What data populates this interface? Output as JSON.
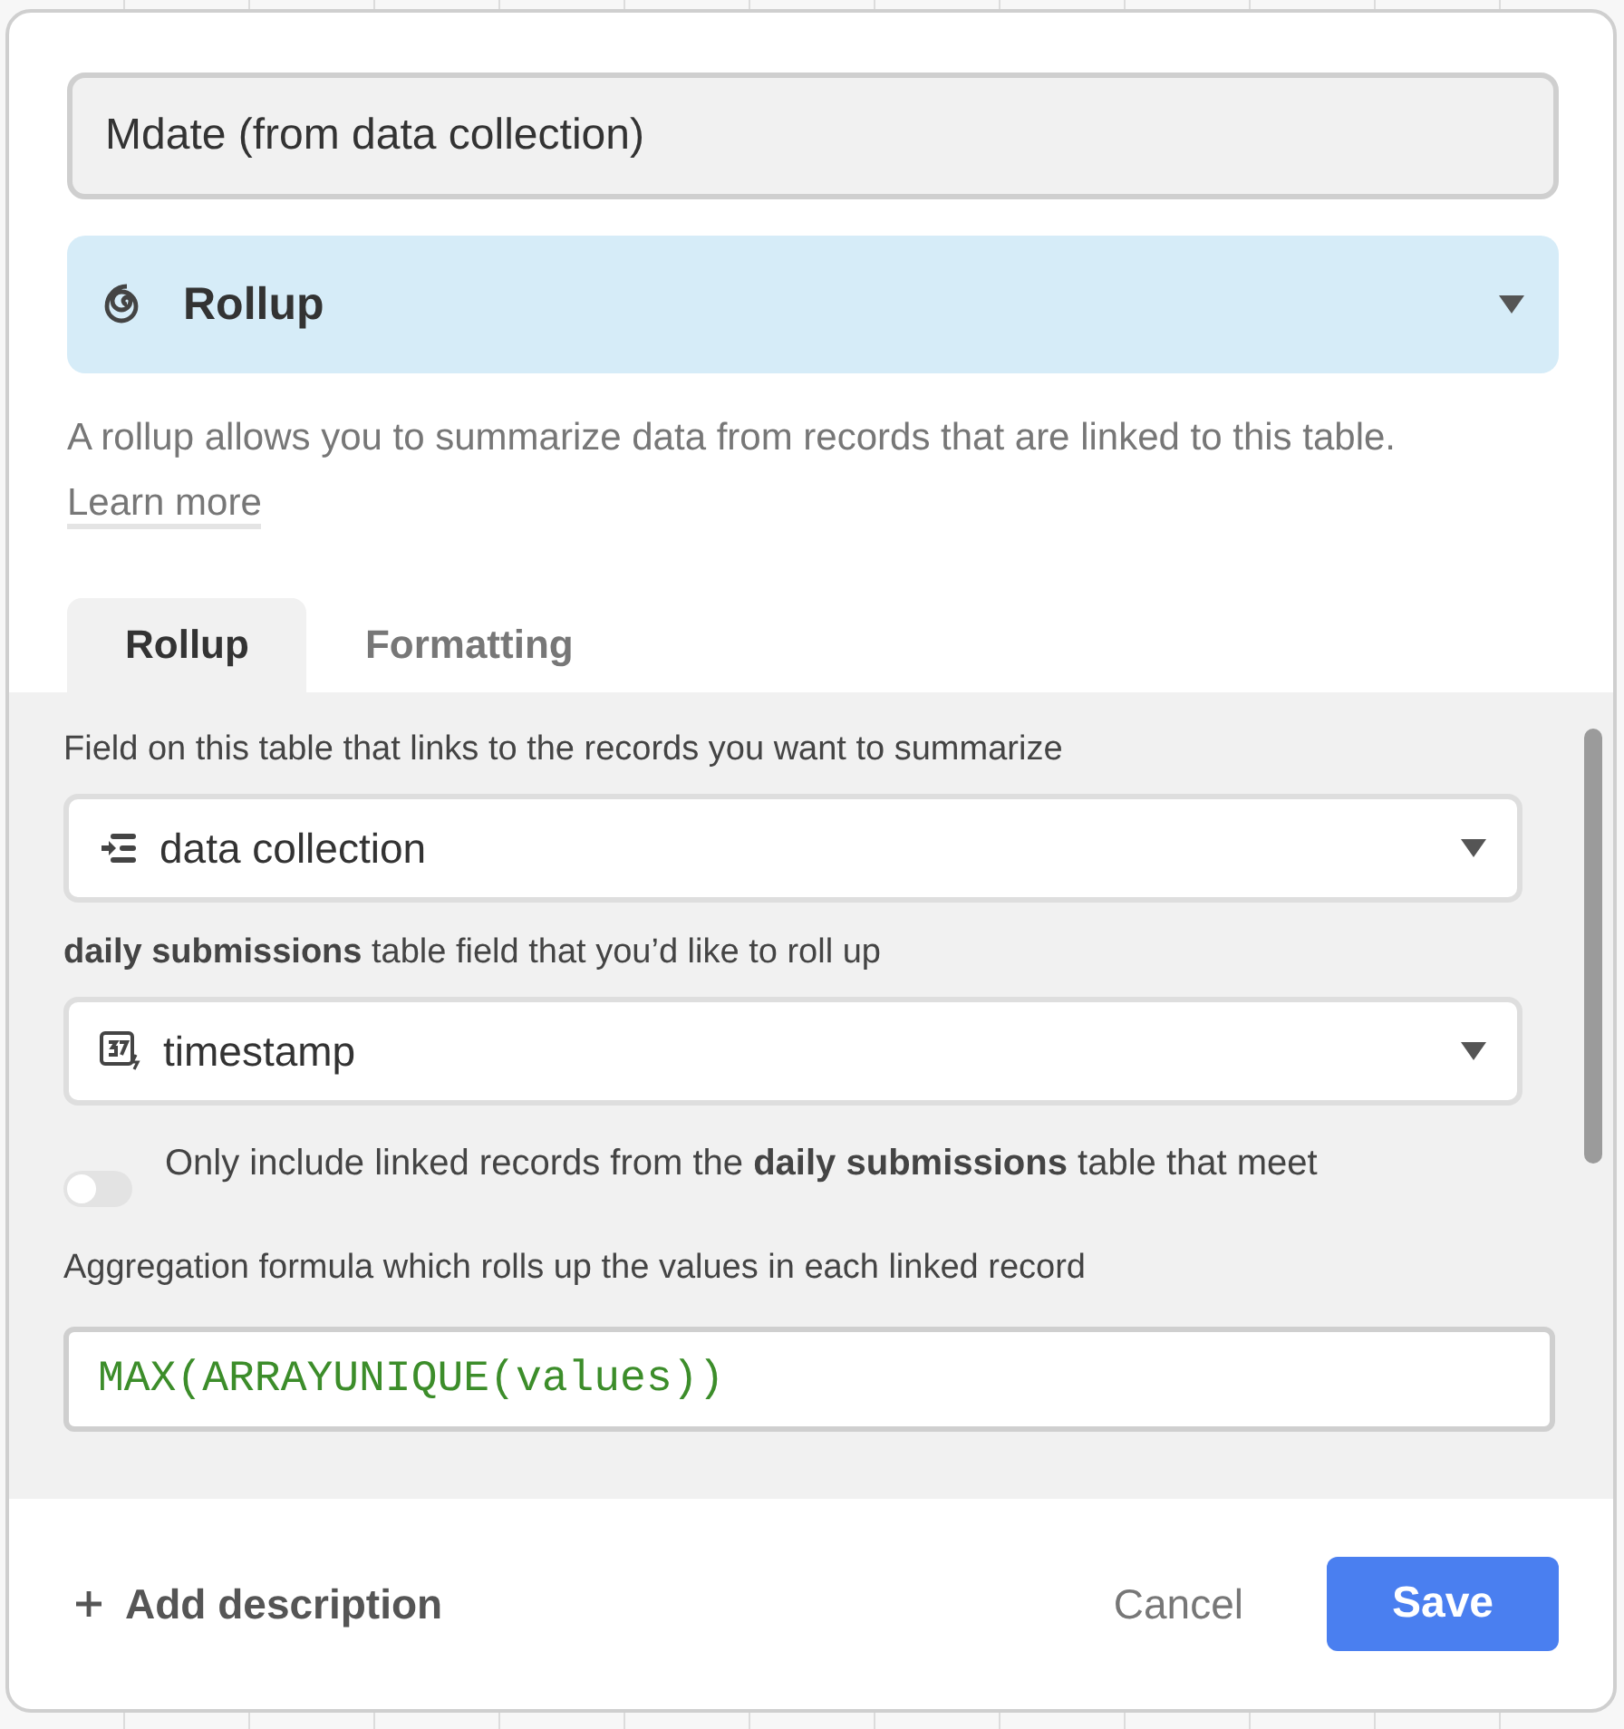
{
  "field_name": {
    "value": "Mdate (from data collection)"
  },
  "field_type": {
    "label": "Rollup"
  },
  "description": {
    "text": "A rollup allows you to summarize data from records that are linked to this table.",
    "link": "Learn more"
  },
  "tabs": [
    {
      "label": "Rollup",
      "selected": true
    },
    {
      "label": "Formatting",
      "selected": false
    }
  ],
  "link_field": {
    "label": "Field on this table that links to the records you want to summarize",
    "value": "data collection"
  },
  "rollup_field": {
    "label": "**daily submissions** table field that you’d like to roll up",
    "value": "timestamp"
  },
  "condition": {
    "label": "Only include linked records from the **daily submissions** table that meet",
    "on": false
  },
  "formula": {
    "label": "Aggregation formula which rolls up the values in each linked record",
    "value": "MAX(ARRAYUNIQUE(values))"
  },
  "footer": {
    "add_description": "Add description",
    "cancel": "Cancel",
    "save": "Save"
  }
}
